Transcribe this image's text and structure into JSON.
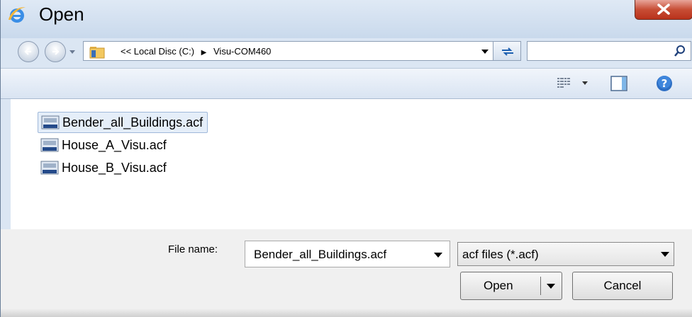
{
  "window": {
    "title": "Open"
  },
  "colors": {
    "accent": "#dbe6f3",
    "close_button": "#c74d35",
    "selection": "#e5eef9"
  },
  "icons": {
    "app": "ie-logo-icon",
    "close": "close-icon",
    "back": "back-arrow-icon",
    "forward": "forward-arrow-icon",
    "folder": "folder-icon",
    "refresh": "refresh-icon",
    "search": "search-icon",
    "views": "views-icon",
    "preview": "preview-pane-icon",
    "help": "help-icon",
    "file": "acf-file-icon"
  },
  "address": {
    "path_prefix": "<< Local Disc (C:)",
    "separator": "▶",
    "folder": "Visu-COM460"
  },
  "search": {
    "placeholder": "",
    "value": ""
  },
  "files": [
    {
      "name": "Bender_all_Buildings.acf",
      "selected": true
    },
    {
      "name": "House_A_Visu.acf",
      "selected": false
    },
    {
      "name": "House_B_Visu.acf",
      "selected": false
    }
  ],
  "footer": {
    "filename_label": "File name:",
    "filename_value": "Bender_all_Buildings.acf",
    "filetype_value": "acf files (*.acf)",
    "open_label": "Open",
    "cancel_label": "Cancel"
  }
}
